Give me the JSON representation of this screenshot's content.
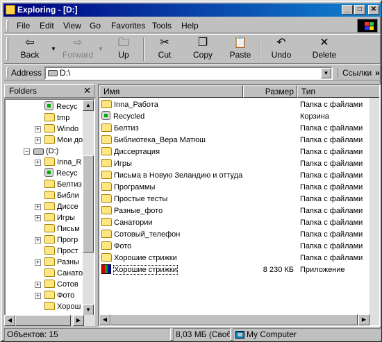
{
  "window": {
    "title": "Exploring - [D:]",
    "min": "_",
    "max": "□",
    "close": "✕"
  },
  "menu": [
    "File",
    "Edit",
    "View",
    "Go",
    "Favorites",
    "Tools",
    "Help"
  ],
  "toolbar": {
    "back": "Back",
    "forward": "Forward",
    "up": "Up",
    "cut": "Cut",
    "copy": "Copy",
    "paste": "Paste",
    "undo": "Undo",
    "delete": "Delete"
  },
  "address": {
    "label": "Address",
    "value": "D:\\",
    "links": "Ссылки",
    "links_chevron": "»"
  },
  "folders": {
    "title": "Folders",
    "close": "✕",
    "items": [
      "Recyc",
      "tmp",
      "Windo",
      "Мои до",
      "(D:)",
      "Inna_R",
      "Recyc",
      "Белтиз",
      "Библи",
      "Диссе",
      "Игры",
      "Письм",
      "Прогр",
      "Прост",
      "Разны",
      "Санато",
      "Сотов",
      "Фото",
      "Хорош"
    ]
  },
  "columns": {
    "name": "Имя",
    "size": "Размер",
    "type": "Тип"
  },
  "files": [
    {
      "name": "Inna_Работа",
      "size": "",
      "type": "Папка с файлами",
      "icon": "folder"
    },
    {
      "name": "Recycled",
      "size": "",
      "type": "Корзина",
      "icon": "recycle-bin"
    },
    {
      "name": "Белтиз",
      "size": "",
      "type": "Папка с файлами",
      "icon": "folder"
    },
    {
      "name": "Библиотека_Вера Матюш",
      "size": "",
      "type": "Папка с файлами",
      "icon": "folder"
    },
    {
      "name": "Диссертация",
      "size": "",
      "type": "Папка с файлами",
      "icon": "folder"
    },
    {
      "name": "Игры",
      "size": "",
      "type": "Папка с файлами",
      "icon": "folder"
    },
    {
      "name": "Письма в Новую Зеландию и оттуда",
      "size": "",
      "type": "Папка с файлами",
      "icon": "folder"
    },
    {
      "name": "Программы",
      "size": "",
      "type": "Папка с файлами",
      "icon": "folder"
    },
    {
      "name": "Простые тесты",
      "size": "",
      "type": "Папка с файлами",
      "icon": "folder"
    },
    {
      "name": "Разные_фото",
      "size": "",
      "type": "Папка с файлами",
      "icon": "folder"
    },
    {
      "name": "Санатории",
      "size": "",
      "type": "Папка с файлами",
      "icon": "folder"
    },
    {
      "name": "Сотовый_телефон",
      "size": "",
      "type": "Папка с файлами",
      "icon": "folder"
    },
    {
      "name": "Фото",
      "size": "",
      "type": "Папка с файлами",
      "icon": "folder"
    },
    {
      "name": "Хорошие стрижки",
      "size": "",
      "type": "Папка с файлами",
      "icon": "folder"
    },
    {
      "name": "Хорошие стрижки",
      "size": "8 230 КБ",
      "type": "Приложение",
      "icon": "application"
    }
  ],
  "status": {
    "objects": "Объектов: 15",
    "free": "8,03 МБ (Свобо",
    "location": "My Computer"
  },
  "colors": {
    "title_start": "#000080",
    "title_end": "#1084d0",
    "face": "#c0c0c0"
  }
}
